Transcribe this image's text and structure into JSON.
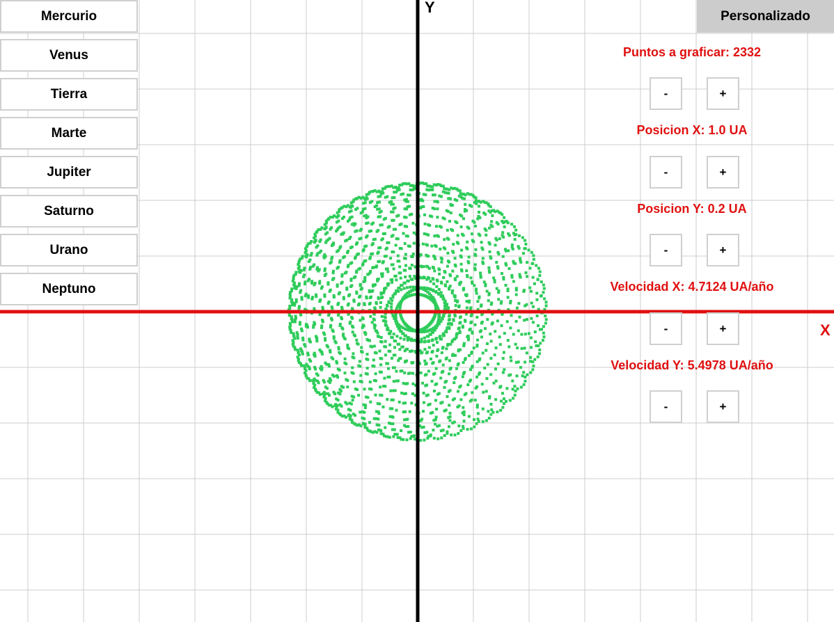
{
  "planets": [
    "Mercurio",
    "Venus",
    "Tierra",
    "Marte",
    "Jupiter",
    "Saturno",
    "Urano",
    "Neptuno"
  ],
  "custom_button": "Personalizado",
  "params": [
    {
      "label": "Puntos a graficar: 2332",
      "minus": "-",
      "plus": "+"
    },
    {
      "label": "Posicion X: 1.0 UA",
      "minus": "-",
      "plus": "+"
    },
    {
      "label": "Posicion Y: 0.2 UA",
      "minus": "-",
      "plus": "+"
    },
    {
      "label": "Velocidad X: 4.7124 UA/año",
      "minus": "-",
      "plus": "+"
    },
    {
      "label": "Velocidad Y: 5.4978 UA/año",
      "minus": "-",
      "plus": "+"
    }
  ],
  "axes": {
    "x_label": "X",
    "y_label": "Y"
  },
  "colors": {
    "grid": "#cccccc",
    "x_axis": "#e01010",
    "y_axis": "#000000",
    "points": "#2ecc5a",
    "label": "#e01010",
    "custom_bg": "#cccccc"
  },
  "orbit": {
    "points": 2332
  }
}
